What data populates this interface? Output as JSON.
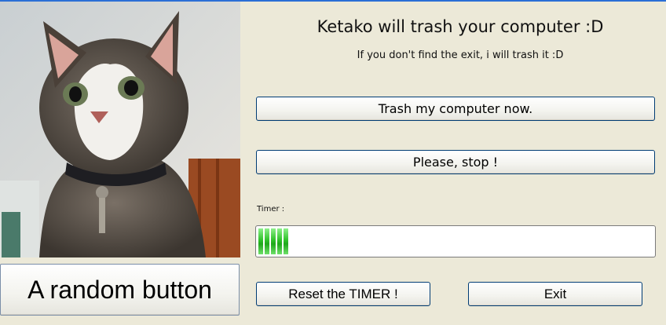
{
  "app": {
    "title": "Ketako will trash your computer :D",
    "subtitle": "If you don't find the exit, i will trash it :D"
  },
  "buttons": {
    "trash": "Trash my computer now.",
    "stop": "Please, stop !",
    "reset": "Reset the TIMER !",
    "exit": "Exit",
    "random": "A random button"
  },
  "timer": {
    "label": "Timer :",
    "progress_fraction": 0.085
  },
  "image": {
    "subject": "cat photo"
  },
  "colors": {
    "window_bg": "#ece9d8",
    "progress_green": "#2fc12a",
    "button_border": "#003c74"
  }
}
